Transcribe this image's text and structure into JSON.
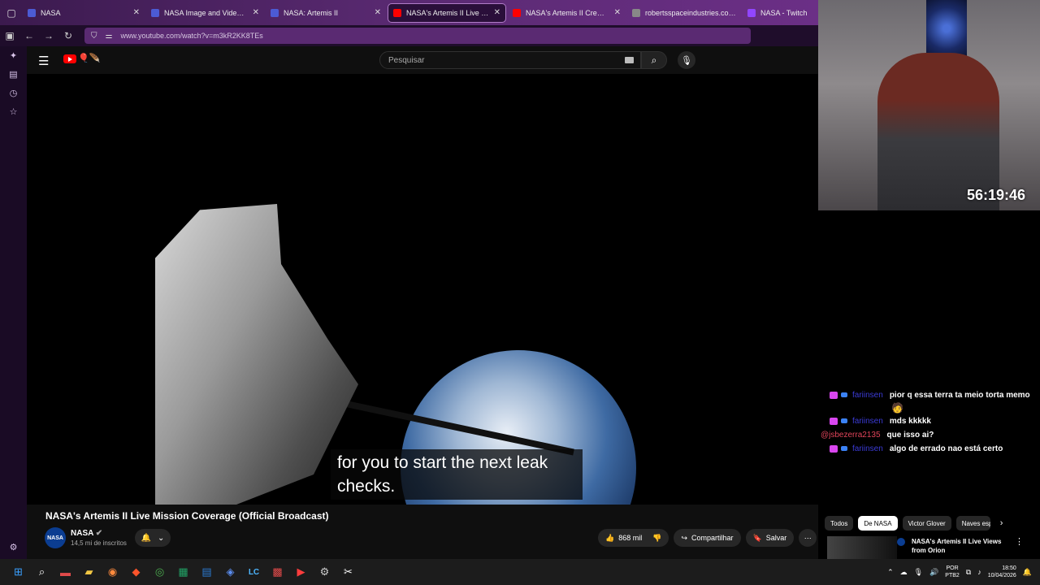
{
  "browser": {
    "tabs": [
      {
        "label": "NASA",
        "color": "#4c5bd4",
        "active": false
      },
      {
        "label": "NASA Image and Video Library",
        "color": "#4c5bd4",
        "active": false
      },
      {
        "label": "NASA: Artemis II",
        "color": "#4c5bd4",
        "active": false
      },
      {
        "label": "NASA's Artemis II Live Missi",
        "color": "#ff0000",
        "active": true
      },
      {
        "label": "NASA's Artemis II Crew Comes",
        "color": "#ff0000",
        "active": false
      },
      {
        "label": "robertsspaceindustries.com/en",
        "color": "#888888",
        "active": false
      },
      {
        "label": "NASA - Twitch",
        "color": "#9146ff",
        "active": false
      }
    ],
    "url": "www.youtube.com/watch?v=m3kR2KK8TEs"
  },
  "youtube": {
    "search_placeholder": "Pesquisar",
    "caption": "for you to start the next leak checks.",
    "video_title": "NASA's Artemis II Live Mission Coverage (Official Broadcast)",
    "channel_name": "NASA",
    "channel_avatar_text": "NASA",
    "subscribers": "14,5 mi de inscritos",
    "likes": "868 mil",
    "share_label": "Compartilhar",
    "save_label": "Salvar",
    "chips": [
      "Todos",
      "De NASA",
      "Victor Glover",
      "Naves esp"
    ],
    "recommended_title": "NASA's Artemis II Live Views from Orion"
  },
  "stream": {
    "timer": "56:19:46"
  },
  "chat": [
    {
      "user": "fariinsen",
      "message": "pior q essa terra ta meio torta memo",
      "user_color": "#3b3bd6"
    },
    {
      "user": "fariinsen",
      "message": "mds kkkkk",
      "user_color": "#3b3bd6"
    },
    {
      "user": "@jsbezerra2135",
      "message": "que isso ai?",
      "user_color": "#e0445a"
    },
    {
      "user": "fariinsen",
      "message": "algo de errado nao está certo",
      "user_color": "#3b3bd6"
    }
  ],
  "taskbar": {
    "lang_top": "POR",
    "lang_bottom": "PTB2",
    "time": "18:50",
    "date": "10/04/2026"
  }
}
